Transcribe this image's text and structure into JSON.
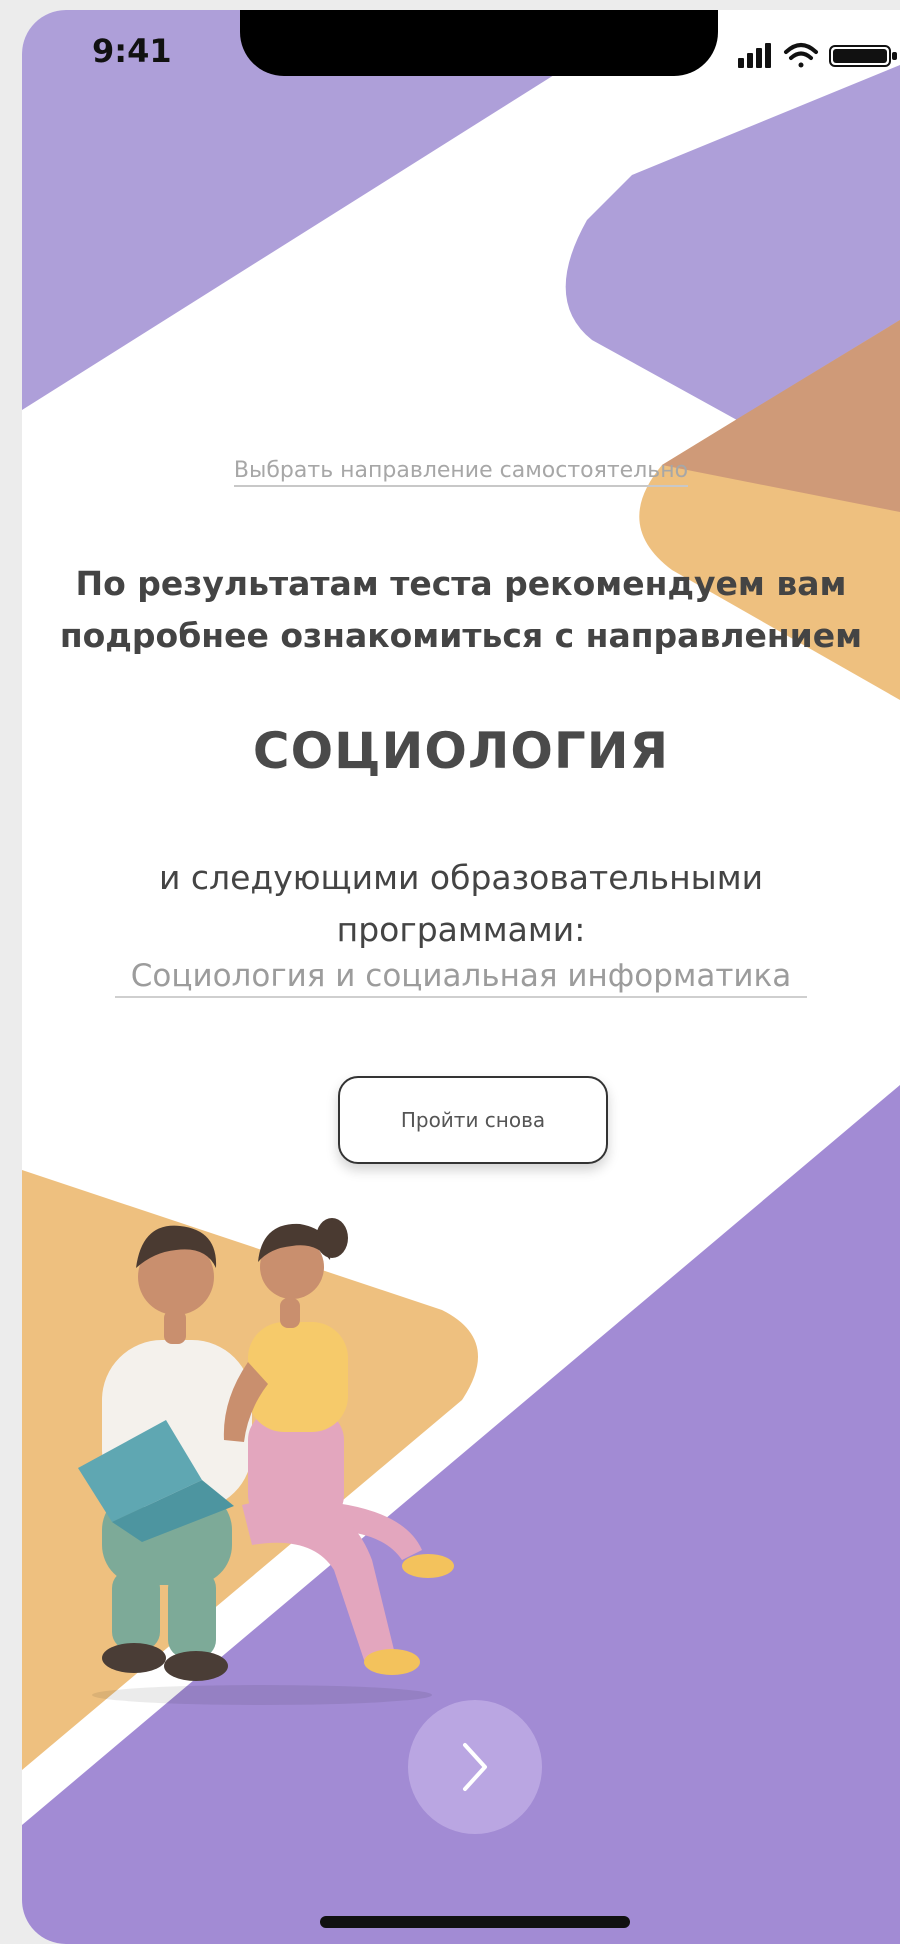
{
  "status_bar": {
    "time": "9:41"
  },
  "links": {
    "self_select": "Выбрать направление самостоятельно"
  },
  "result": {
    "recommendation_line1": "По результатам теста рекомендуем вам",
    "recommendation_line2": "подробнее ознакомиться с направлением",
    "direction": "СОЦИОЛОГИЯ",
    "programs_intro_line1": "и следующими образовательными",
    "programs_intro_line2": "программами:",
    "programs": [
      "Социология и социальная информатика"
    ]
  },
  "actions": {
    "retry_label": "Пройти снова"
  },
  "icons": {
    "signal": "signal-icon",
    "wifi": "wifi-icon",
    "battery": "battery-icon",
    "next": "chevron-right-icon"
  },
  "colors": {
    "lavender": "#ae9fd9",
    "purple": "#a28bd4",
    "orange": "#eec07f",
    "brown": "#cf9a78",
    "text": "#444444"
  }
}
